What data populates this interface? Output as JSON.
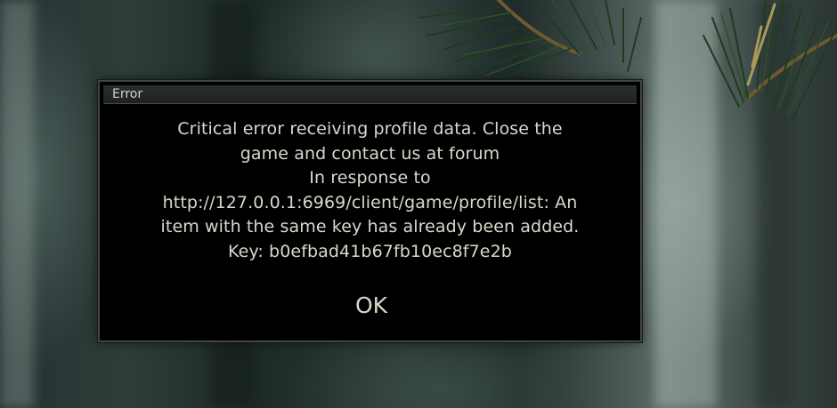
{
  "dialog": {
    "title": "Error",
    "message_lines": [
      "Critical error receiving profile data. Close the",
      "game and contact us at forum",
      "In response to",
      "http://127.0.0.1:6969/client/game/profile/list: An",
      "item with the same key has already been added.",
      "Key: b0efbad41b67fb10ec8f7e2b"
    ],
    "ok_label": "OK"
  },
  "colors": {
    "dialog_background": "#000000",
    "dialog_border": "#3f4645",
    "text": "#d8d8cc",
    "title_bar": "#2b2f2e"
  }
}
